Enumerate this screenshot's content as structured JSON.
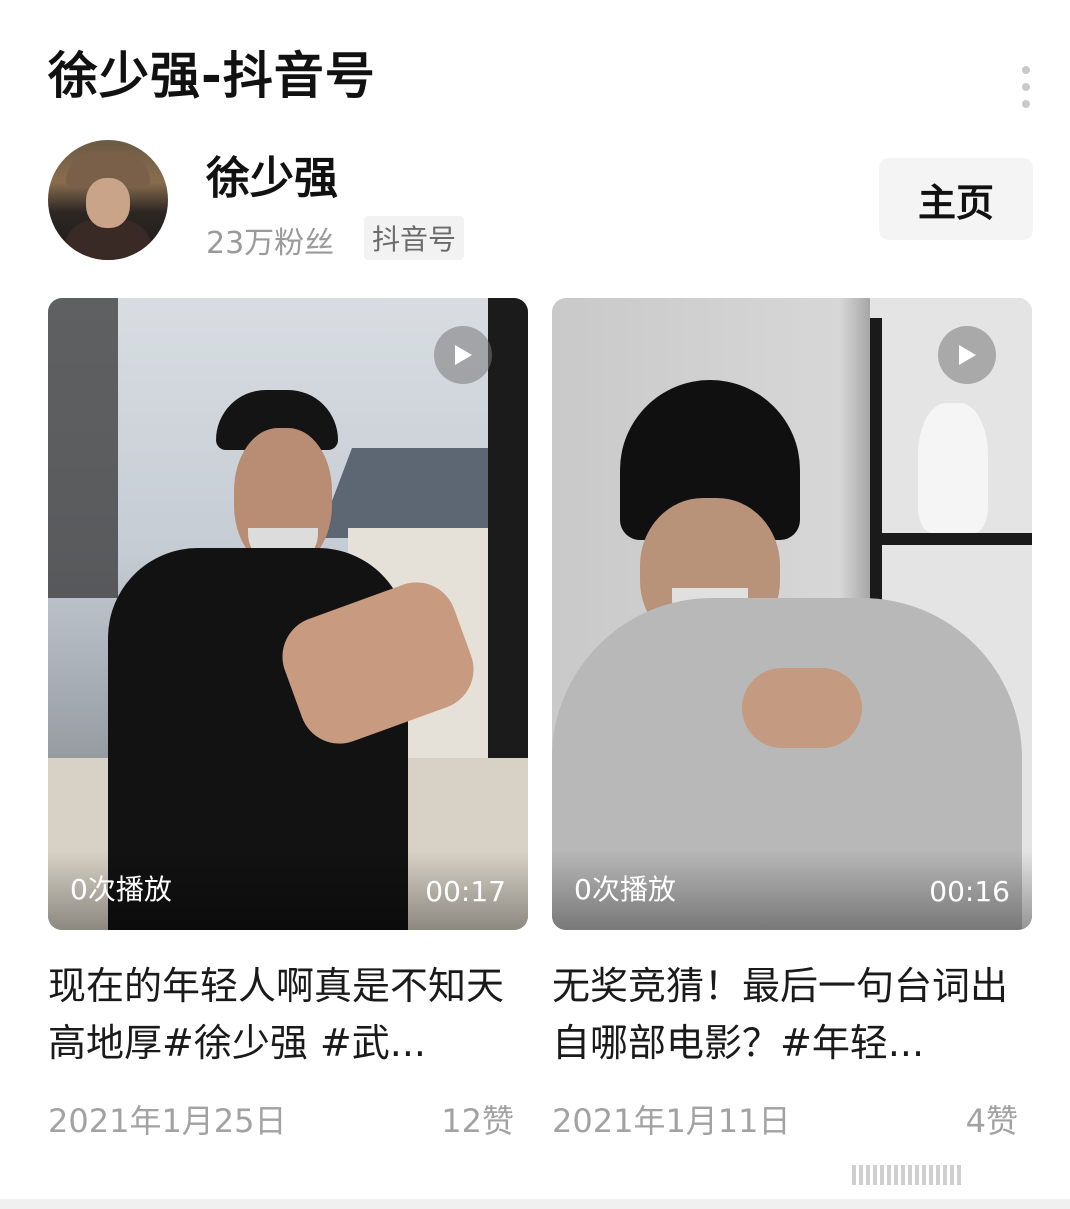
{
  "header": {
    "title": "徐少强-抖音号"
  },
  "profile": {
    "name": "徐少强",
    "fans": "23万粉丝",
    "platform_tag": "抖音号",
    "home_button": "主页"
  },
  "videos": [
    {
      "plays": "0次播放",
      "duration": "00:17",
      "title": "现在的年轻人啊真是不知天高地厚#徐少强 #武...",
      "date": "2021年1月25日",
      "likes": "12赞"
    },
    {
      "plays": "0次播放",
      "duration": "00:16",
      "title": "无奖竞猜！最后一句台词出自哪部电影？#年轻...",
      "date": "2021年1月11日",
      "likes": "4赞"
    }
  ],
  "icons": {
    "more": "more-vertical-icon",
    "play": "play-icon"
  },
  "colors": {
    "text_primary": "#111111",
    "text_secondary": "#9a9a9a",
    "button_bg": "#f4f4f4"
  }
}
